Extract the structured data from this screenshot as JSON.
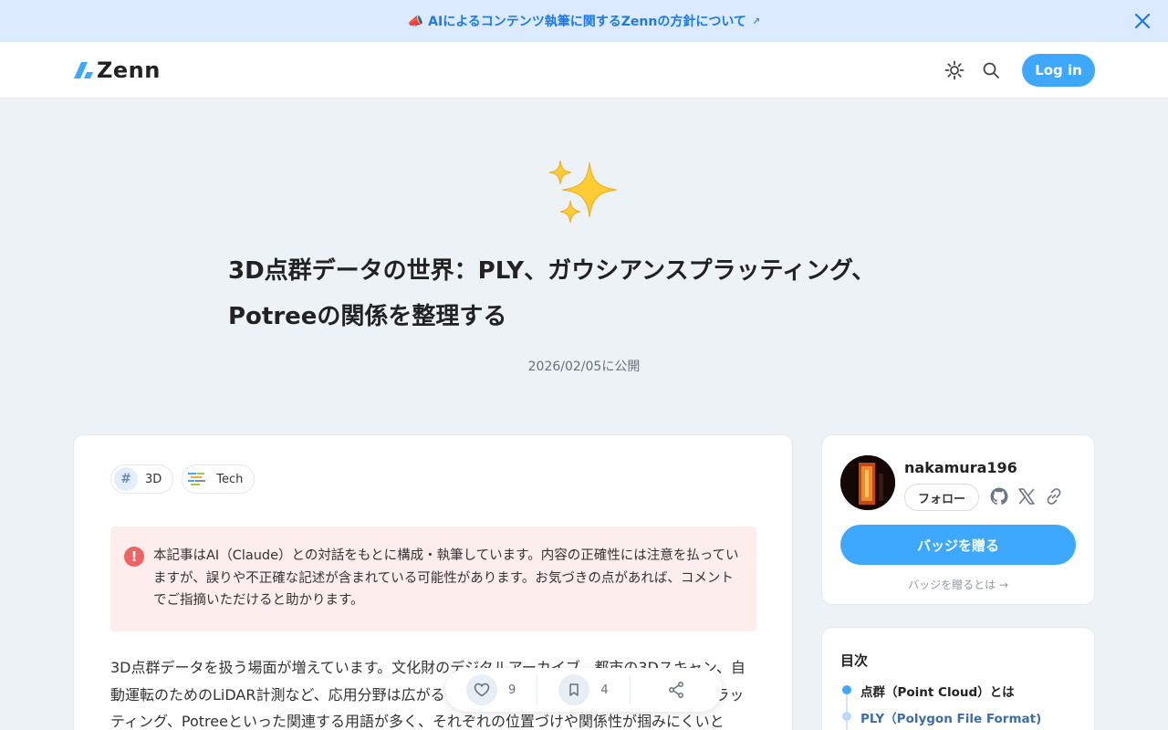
{
  "banner": {
    "text": "📣 AIによるコンテンツ執筆に関するZennの方針について",
    "arrow": "↗",
    "close_icon": "close-icon"
  },
  "header": {
    "logo_text": "Zenn",
    "theme_icon": "sun-icon",
    "search_icon": "search-icon",
    "login_label": "Log in"
  },
  "article": {
    "emoji": "sparkles",
    "title": "3D点群データの世界：PLY、ガウシアンスプラッティング、Potreeの関係を整理する",
    "published": "2026/02/05に公開",
    "tags": [
      {
        "icon": "#",
        "label": "3D"
      },
      {
        "icon": "tech-icon",
        "label": "Tech"
      }
    ],
    "alert_text": "本記事はAI（Claude）との対話をもとに構成・執筆しています。内容の正確性には注意を払っていますが、誤りや不正確な記述が含まれている可能性があります。お気づきの点があれば、コメントでご指摘いただけると助かります。",
    "body": "3D点群データを扱う場面が増えています。文化財のデジタルアーカイブ、都市の3Dスキャン、自動運転のためのLiDAR計測など、応用分野は広がる一方です。しかし、PLY、ガウシアンスプラッティング、Potreeといった関連する用語が多く、それぞれの位置づけや関係性が掴みにくいと"
  },
  "actions": {
    "like_count": "9",
    "bookmark_count": "4"
  },
  "author": {
    "name": "nakamura196",
    "follow_label": "フォロー",
    "badge_button": "バッジを贈る",
    "badge_link": "バッジを贈るとは →"
  },
  "toc": {
    "title": "目次",
    "items": [
      {
        "label": "点群（Point Cloud）とは"
      },
      {
        "label": "PLY（Polygon File Format)"
      }
    ]
  },
  "colors": {
    "accent": "#3ea8ff",
    "banner_bg": "#dbeafe",
    "page_bg": "#edf2f7",
    "alert_bg": "#fdeeed"
  }
}
